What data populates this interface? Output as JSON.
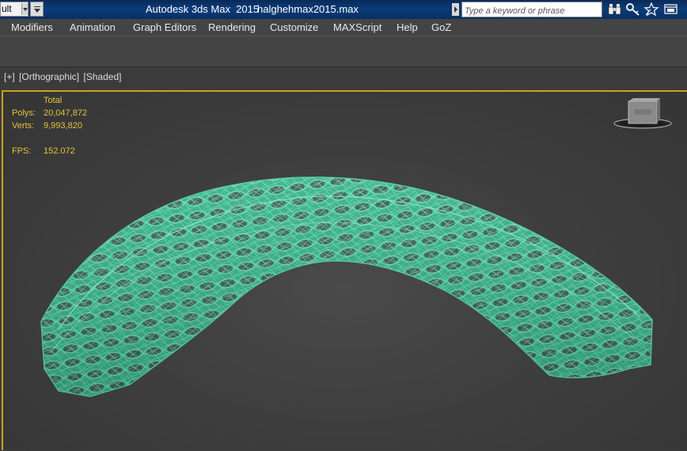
{
  "titlebar": {
    "workspace_value": "ult",
    "app_title": "Autodesk 3ds Max  2015",
    "file_name": "halghehmax2015.max",
    "search_placeholder": "Type a keyword or phrase"
  },
  "menu": {
    "items": [
      "Modifiers",
      "Animation",
      "Graph Editors",
      "Rendering",
      "Customize",
      "MAXScript",
      "Help",
      "GoZ"
    ]
  },
  "viewport": {
    "labels": [
      "[+]",
      "[Orthographic]",
      "[Shaded]"
    ],
    "active_border_color": "#c9a31c",
    "stats": {
      "header": "Total",
      "polys_label": "Polys:",
      "polys_value": "20,047,872",
      "verts_label": "Verts:",
      "verts_value": "9,993,820",
      "fps_label": "FPS:",
      "fps_value": "152.072"
    },
    "stats_color": "#e3c33a",
    "model_color": "#4fd1a6",
    "viewcube_icon": "viewcube-icon"
  },
  "icons": {
    "binoculars": "binoculars-icon",
    "key": "key-icon",
    "star": "star-icon",
    "exchange": "exchange-icon"
  }
}
